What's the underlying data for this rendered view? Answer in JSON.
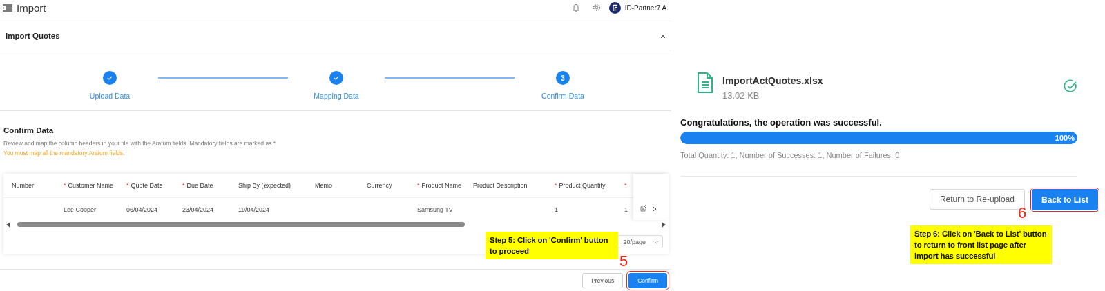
{
  "topbar": {
    "title": "Import",
    "user": "ID-Partner7 A."
  },
  "dialog": {
    "title": "Import Quotes"
  },
  "steps": [
    {
      "label": "Upload Data",
      "done": true
    },
    {
      "label": "Mapping Data",
      "done": true
    },
    {
      "label": "Confirm Data",
      "done": false,
      "number": "3"
    }
  ],
  "section": {
    "title": "Confirm Data",
    "description": "Review and map the column headers in your file with the Aratum fields. Mandatory fields are marked as *",
    "warning": "You must map all the mandatory Aratum fields."
  },
  "table": {
    "columns": [
      {
        "label": "Number"
      },
      {
        "marker": "*",
        "label": "Customer Name"
      },
      {
        "marker": "*",
        "label": "Quote Date"
      },
      {
        "marker": "*",
        "label": "Due Date"
      },
      {
        "label": "Ship By (expected)"
      },
      {
        "label": "Memo"
      },
      {
        "label": "Currency"
      },
      {
        "marker": "*",
        "label": "Product Name"
      },
      {
        "label": "Product Description"
      },
      {
        "marker": "*",
        "label": "Product Quantity"
      },
      {
        "marker": "*"
      }
    ],
    "rows": [
      {
        "cells": [
          null,
          "Lee Cooper",
          "06/04/2024",
          "23/04/2024",
          "19/04/2024",
          null,
          null,
          "Samsung TV",
          null,
          "1",
          "1"
        ]
      }
    ]
  },
  "pagination": {
    "page_size": "20/page"
  },
  "buttons": [
    {
      "label": "Previous",
      "kind": "secondary",
      "highlighted": false
    },
    {
      "label": "Confirm",
      "kind": "primary",
      "highlighted": true
    }
  ],
  "annotation_left": {
    "text": "Step 5: Click on 'Confirm' button to proceed",
    "number": "5"
  },
  "result": {
    "file_name": "ImportActQuotes.xlsx",
    "file_size": "13.02 KB",
    "message": "Congratulations, the operation was successful.",
    "progress": {
      "level": 1,
      "reading": "100%"
    },
    "summary": "Total Quantity: 1, Number of Successes: 1, Number of Failures: 0"
  },
  "result_buttons": [
    {
      "label": "Return to Re-upload",
      "kind": "secondary",
      "highlighted": false
    },
    {
      "label": "Back to List",
      "kind": "primary",
      "highlighted": true
    }
  ],
  "annotation_right": {
    "text": "Step 6: Click on 'Back to List' button to return to front list page after import has successful",
    "number": "6"
  }
}
